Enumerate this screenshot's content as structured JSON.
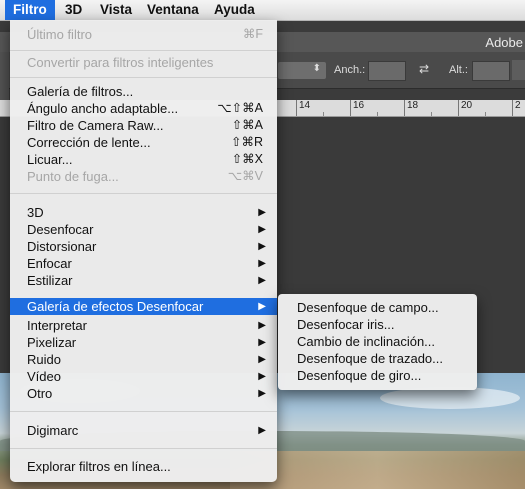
{
  "menubar": {
    "items": [
      {
        "label": "Filtro",
        "active": true
      },
      {
        "label": "3D"
      },
      {
        "label": "Vista"
      },
      {
        "label": "Ventana"
      },
      {
        "label": "Ayuda"
      }
    ]
  },
  "background_app": {
    "window_title": "Adobe",
    "options_bar": {
      "dropdown_arrow": "⬍",
      "width_label": "Anch.:",
      "swap_symbol": "⇄",
      "height_label": "Alt.:"
    },
    "ruler_ticks": [
      "14",
      "16",
      "18",
      "20",
      "2"
    ]
  },
  "filter_menu": {
    "items": [
      {
        "label": "Último filtro",
        "shortcut": "⌘F",
        "disabled": true
      },
      {
        "label": "Convertir para filtros inteligentes",
        "disabled": true
      },
      {
        "label": "Galería de filtros..."
      },
      {
        "label": "Ángulo ancho adaptable...",
        "shortcut": "⌥⇧⌘A"
      },
      {
        "label": "Filtro de Camera Raw...",
        "shortcut": "⇧⌘A"
      },
      {
        "label": "Corrección de lente...",
        "shortcut": "⇧⌘R"
      },
      {
        "label": "Licuar...",
        "shortcut": "⇧⌘X"
      },
      {
        "label": "Punto de fuga...",
        "shortcut": "⌥⌘V",
        "disabled": true
      },
      {
        "label": "3D",
        "submenu": true
      },
      {
        "label": "Desenfocar",
        "submenu": true
      },
      {
        "label": "Distorsionar",
        "submenu": true
      },
      {
        "label": "Enfocar",
        "submenu": true
      },
      {
        "label": "Estilizar",
        "submenu": true
      },
      {
        "label": "Galería de efectos Desenfocar",
        "submenu": true,
        "highlighted": true
      },
      {
        "label": "Interpretar",
        "submenu": true
      },
      {
        "label": "Pixelizar",
        "submenu": true
      },
      {
        "label": "Ruido",
        "submenu": true
      },
      {
        "label": "Vídeo",
        "submenu": true
      },
      {
        "label": "Otro",
        "submenu": true
      },
      {
        "label": "Digimarc",
        "submenu": true
      },
      {
        "label": "Explorar filtros en línea..."
      }
    ],
    "submenu_arrow": "▶"
  },
  "blur_gallery_submenu": {
    "items": [
      {
        "label": "Desenfoque de campo..."
      },
      {
        "label": "Desenfocar iris..."
      },
      {
        "label": "Cambio de inclinación..."
      },
      {
        "label": "Desenfoque de trazado..."
      },
      {
        "label": "Desenfoque de giro..."
      }
    ]
  },
  "colors": {
    "highlight": "#1f6ee0",
    "menu_bg": "#eeeeee",
    "disabled_text": "#a6a6a6"
  }
}
